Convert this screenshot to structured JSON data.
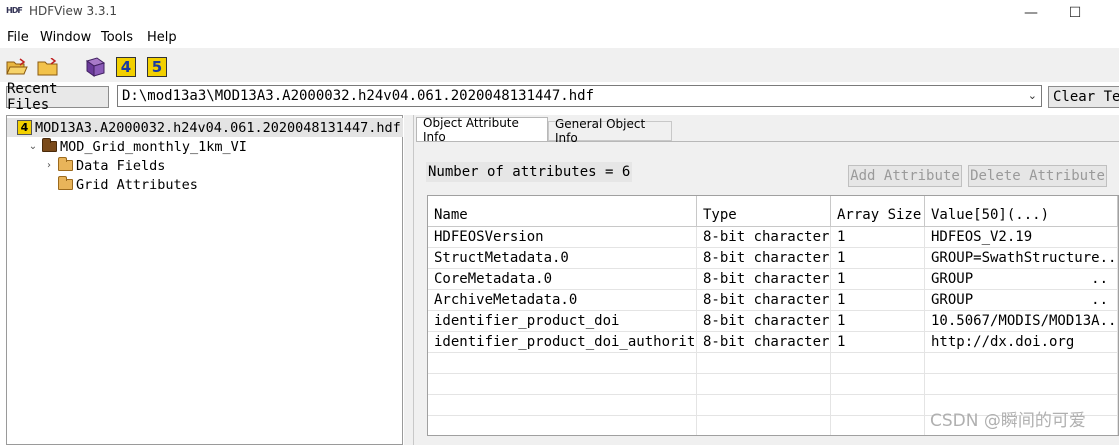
{
  "window": {
    "title": "HDFView 3.3.1",
    "logo_text": "HDF",
    "minimize_glyph": "—",
    "maximize_glyph": "☐"
  },
  "menu": [
    "File",
    "Window",
    "Tools",
    "Help"
  ],
  "toolbar": {
    "icons": [
      "open-file-icon",
      "open-folder-icon",
      "help-book-icon",
      "hdf4-library-icon",
      "hdf5-library-icon"
    ],
    "hdf4_label": "4",
    "hdf5_label": "5"
  },
  "recent": {
    "button_label": "Recent Files",
    "current_file": "D:\\mod13a3\\MOD13A3.A2000032.h24v04.061.2020048131447.hdf",
    "clear_label": "Clear Text"
  },
  "tree": {
    "root": {
      "label": "MOD13A3.A2000032.h24v04.061.2020048131447.hdf",
      "icon_text": "4"
    },
    "group": {
      "label": "MOD_Grid_monthly_1km_VI",
      "arrow": "⌄"
    },
    "children": [
      {
        "label": "Data Fields",
        "arrow": "›"
      },
      {
        "label": "Grid Attributes",
        "arrow": ""
      }
    ]
  },
  "tabs": {
    "attribute": "Object Attribute Info",
    "general": "General Object Info"
  },
  "attributes": {
    "count_text": "Number of attributes = 6",
    "add_label": "Add Attribute",
    "delete_label": "Delete Attribute",
    "columns": [
      "Name",
      "Type",
      "Array Size",
      "Value[50](...)"
    ],
    "rows": [
      [
        "HDFEOSVersion",
        "8-bit character",
        "1",
        "HDFEOS_V2.19"
      ],
      [
        "StructMetadata.0",
        "8-bit character",
        "1",
        "GROUP=SwathStructure.."
      ],
      [
        "CoreMetadata.0",
        "8-bit character",
        "1",
        "GROUP              .."
      ],
      [
        "ArchiveMetadata.0",
        "8-bit character",
        "1",
        "GROUP              .."
      ],
      [
        "identifier_product_doi",
        "8-bit character",
        "1",
        "10.5067/MODIS/MOD13A.."
      ],
      [
        "identifier_product_doi_authority",
        "8-bit character",
        "1",
        "http://dx.doi.org"
      ]
    ]
  },
  "watermark": "CSDN @瞬间的可爱"
}
